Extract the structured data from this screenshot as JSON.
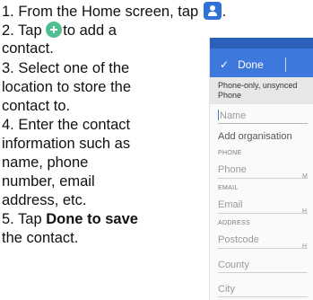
{
  "steps": {
    "s1": {
      "text": "1. From the Home screen, tap",
      "tail": "."
    },
    "s2": {
      "l1a": "2. Tap",
      "l1b": "to add a",
      "l2": "contact."
    },
    "s3": {
      "l1": "3. Select one of the",
      "l2": "location to store the",
      "l3": "contact to."
    },
    "s4": {
      "l1": "4. Enter the contact",
      "l2": "information such as",
      "l3": "name, phone",
      "l4": "number, email",
      "l5": "address, etc."
    },
    "s5": {
      "l1a": "5. Tap ",
      "l1b": "Done to save",
      "l2": "the contact."
    }
  },
  "phone": {
    "done_label": "Done",
    "banner_l1": "Phone-only, unsynced",
    "banner_l2": "Phone",
    "name_placeholder": "Name",
    "add_org": "Add organisation",
    "sections": {
      "phone": "PHONE",
      "email": "EMAIL",
      "address": "ADDRESS"
    },
    "fields": {
      "phone": "Phone",
      "email": "Email",
      "postcode": "Postcode",
      "county": "County",
      "city": "City"
    },
    "side_labels": {
      "phone": "M",
      "email": "H",
      "address": "H"
    }
  },
  "icons": {
    "contacts_app": "contacts-app-icon",
    "add": "add-contact-icon"
  },
  "colors": {
    "accent": "#3d78dc",
    "add_button": "#4fbf8f",
    "contacts_icon": "#2f72d6"
  }
}
